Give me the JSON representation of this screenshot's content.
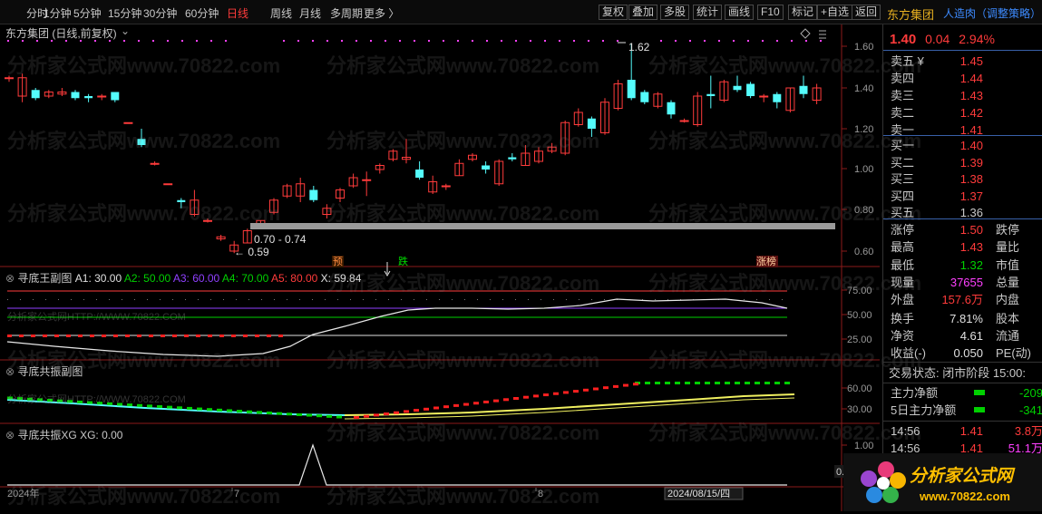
{
  "periods": [
    "分时",
    "1分钟",
    "5分钟",
    "15分钟",
    "30分钟",
    "60分钟",
    "日线",
    "周线",
    "月线",
    "多周期",
    "更多 〉"
  ],
  "active_period": "日线",
  "tools": [
    "复权",
    "叠加",
    "多股",
    "统计",
    "画线",
    "F10",
    "标记",
    "+自选",
    "返回"
  ],
  "symbol": "东方集团",
  "strategy": "人造肉（调整策略）",
  "main": {
    "title": "东方集团 (日线,前复权)",
    "y_ticks": [
      "1.60",
      "1.40",
      "1.20",
      "1.00",
      "0.80",
      "0.60"
    ],
    "high_label": "1.62",
    "low_label": "0.59",
    "range_label": "0.70 - 0.74",
    "marker_yu": "预",
    "marker_die": "跌",
    "marker_zb": "涨榜"
  },
  "ind1": {
    "name": "寻底王副图",
    "a1": "A1: 30.00",
    "a2": "A2: 50.00",
    "a3": "A3: 60.00",
    "a4": "A4: 70.00",
    "a5": "A5: 80.00",
    "x": "X: 59.84",
    "y_ticks": [
      "75.00",
      "50.00",
      "25.00"
    ],
    "watermark": "分析家公式网HTTP://WWW.70822.COM"
  },
  "ind2": {
    "name": "寻底共振副图",
    "y_ticks": [
      "60.00",
      "30.00"
    ],
    "watermark": "分析家公式网HTTP://WWW.70822.COM"
  },
  "ind3": {
    "name": "寻底共振XG",
    "xg": "XG: 0.00",
    "y_ticks": [
      "1.00",
      "0.50"
    ],
    "tick_small": "0.1"
  },
  "x_axis": {
    "start": "2024年",
    "m7": "7",
    "m8": "8",
    "date": "2024/08/15/四",
    "end": "E"
  },
  "colors": {
    "up": "#ff3b3b",
    "down": "#54fcfc",
    "bg": "#000000",
    "accent": "#e8b020"
  },
  "quote": {
    "price": "1.40",
    "change": "0.04",
    "pct": "2.94%"
  },
  "orderbook": [
    {
      "label": "卖五 ¥",
      "price": "1.45",
      "vol": ""
    },
    {
      "label": "卖四",
      "price": "1.44",
      "vol": ""
    },
    {
      "label": "卖三",
      "price": "1.43",
      "vol": ""
    },
    {
      "label": "卖二",
      "price": "1.42",
      "vol": ""
    },
    {
      "label": "卖一",
      "price": "1.41",
      "vol": ""
    },
    {
      "label": "买一",
      "price": "1.40",
      "vol": ""
    },
    {
      "label": "买二",
      "price": "1.39",
      "vol": ""
    },
    {
      "label": "买三",
      "price": "1.38",
      "vol": ""
    },
    {
      "label": "买四",
      "price": "1.37",
      "vol": ""
    },
    {
      "label": "买五",
      "price": "1.36",
      "vol": ""
    }
  ],
  "stats": [
    {
      "l": "涨停",
      "v": "1.50",
      "r": "跌停",
      "vc": "red"
    },
    {
      "l": "最高",
      "v": "1.43",
      "r": "量比",
      "vc": "red"
    },
    {
      "l": "最低",
      "v": "1.32",
      "r": "市值",
      "vc": "green"
    },
    {
      "l": "现量",
      "v": "37655",
      "r": "总量",
      "vc": "mag"
    },
    {
      "l": "外盘",
      "v": "157.6万",
      "r": "内盘",
      "vc": "red"
    },
    {
      "l": "换手",
      "v": "7.81%",
      "r": "股本",
      "vc": "white"
    },
    {
      "l": "净资",
      "v": "4.61",
      "r": "流通",
      "vc": "white"
    },
    {
      "l": "收益(-)",
      "v": "0.050",
      "r": "PE(动)",
      "vc": "white"
    }
  ],
  "trade_state": "交易状态: 闭市阶段 15:00:",
  "flows": [
    {
      "label": "主力净额",
      "value": "-209"
    },
    {
      "label": "5日主力净额",
      "value": "-341"
    }
  ],
  "ticks": [
    {
      "time": "14:56",
      "price": "1.41",
      "vol": "3.8万"
    },
    {
      "time": "14:56",
      "price": "1.41",
      "vol": "51.1万"
    }
  ],
  "logo": {
    "name": "分析家公式网",
    "url": "www.70822.com"
  },
  "watermark_text": "分析家公式网www.70822.com"
}
